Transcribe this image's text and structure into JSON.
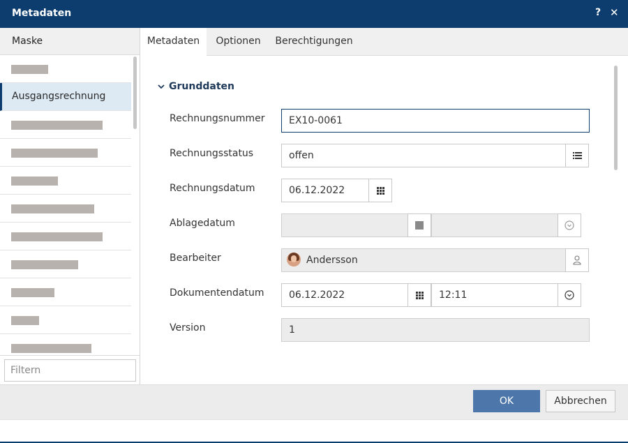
{
  "window": {
    "title": "Metadaten",
    "help_label": "?",
    "close_label": "✕"
  },
  "left_pane": {
    "header": "Maske",
    "selected_item": "Ausgangsrechnung",
    "filter_placeholder": "Filtern"
  },
  "tabs": [
    {
      "label": "Metadaten",
      "active": true
    },
    {
      "label": "Optionen",
      "active": false
    },
    {
      "label": "Berechtigungen",
      "active": false
    }
  ],
  "section": {
    "title": "Grunddaten",
    "chevron": "chevron-down-icon"
  },
  "fields": {
    "rechnungsnummer": {
      "label": "Rechnungsnummer",
      "value": "EX10-0061"
    },
    "rechnungsstatus": {
      "label": "Rechnungsstatus",
      "value": "offen"
    },
    "rechnungsdatum": {
      "label": "Rechnungsdatum",
      "value": "06.12.2022"
    },
    "ablagedatum": {
      "label": "Ablagedatum",
      "date_value": "",
      "time_value": ""
    },
    "bearbeiter": {
      "label": "Bearbeiter",
      "value": "Andersson"
    },
    "dokumentendatum": {
      "label": "Dokumentendatum",
      "date_value": "06.12.2022",
      "time_value": "12:11"
    },
    "version": {
      "label": "Version",
      "value": "1"
    }
  },
  "footer": {
    "ok_label": "OK",
    "cancel_label": "Abbrechen"
  },
  "colors": {
    "titlebar": "#0c3d6e",
    "accent": "#4d77aa",
    "selected_bg": "#dde9f3"
  }
}
